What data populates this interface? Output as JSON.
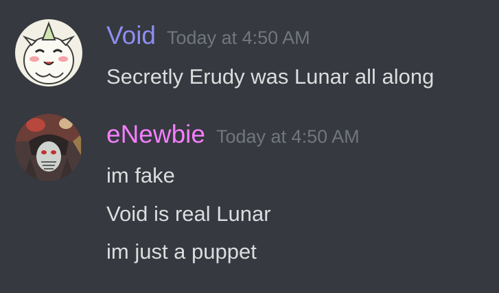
{
  "colors": {
    "background": "#36393f",
    "message_text": "#dcddde",
    "timestamp": "#72767d"
  },
  "messages": [
    {
      "author": "Void",
      "author_color": "#8e8ef1",
      "avatar_icon": "chibi-white-creature-avatar",
      "timestamp": "Today at 4:50 AM",
      "lines": [
        "Secretly Erudy was Lunar all along"
      ]
    },
    {
      "author": "eNewbie",
      "author_color": "#f47fff",
      "avatar_icon": "dark-armored-skull-figure-avatar",
      "timestamp": "Today at 4:50 AM",
      "lines": [
        "im fake",
        "Void is real Lunar",
        "im just a puppet"
      ]
    }
  ]
}
